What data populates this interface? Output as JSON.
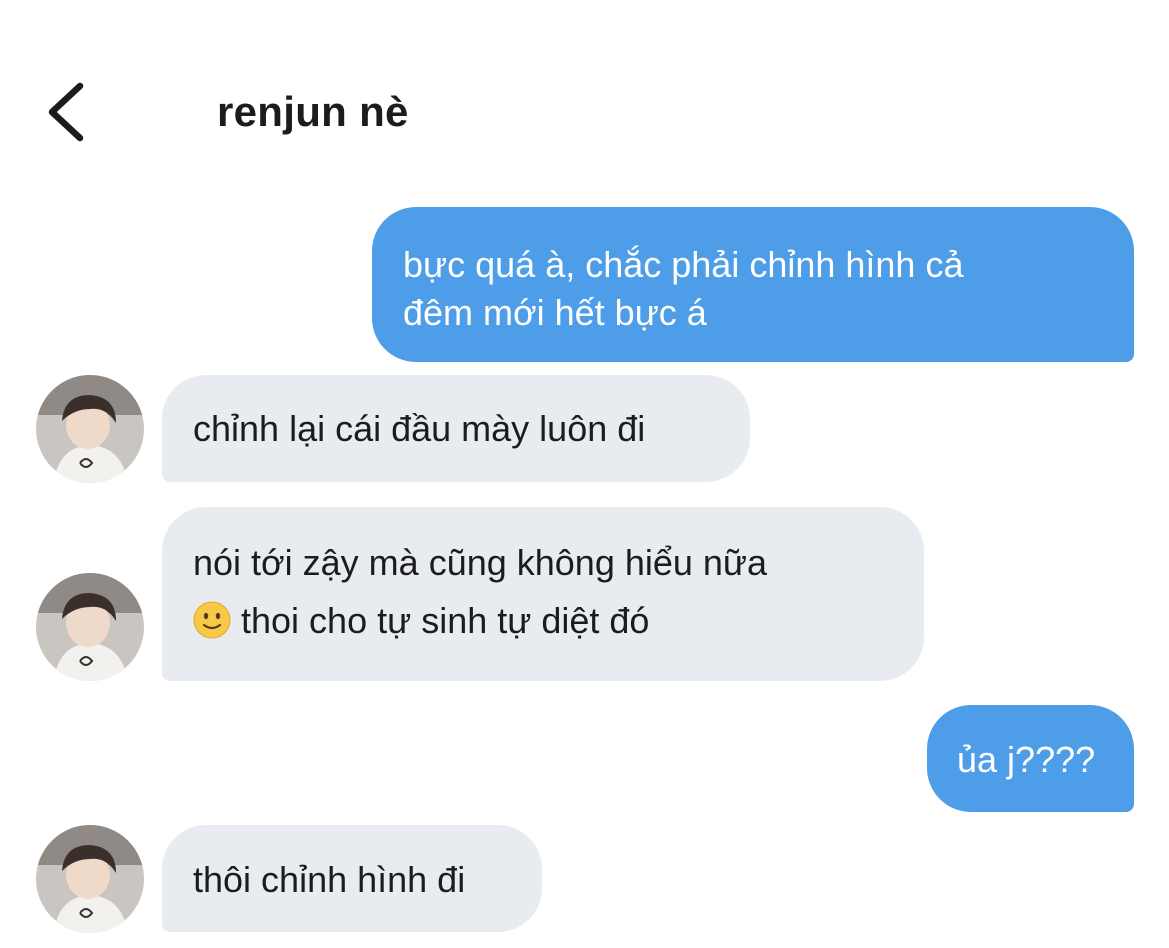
{
  "header": {
    "title": "renjun nè"
  },
  "messages": [
    {
      "direction": "outgoing",
      "lines": [
        "bực quá à, chắc phải chỉnh hình cả",
        "đêm mới hết bực á"
      ]
    },
    {
      "direction": "incoming",
      "lines": [
        "chỉnh lại cái đầu mày luôn đi"
      ]
    },
    {
      "direction": "incoming",
      "lines": [
        "nói tới zậy mà cũng không hiểu nữa",
        "thoi cho tự sinh tự diệt đó"
      ],
      "emoji": "slightly-smiling-face"
    },
    {
      "direction": "outgoing",
      "lines": [
        "ủa j????"
      ]
    },
    {
      "direction": "incoming",
      "lines": [
        "thôi chỉnh hình đi"
      ]
    }
  ],
  "colors": {
    "outgoing_bubble": "#4d9de9",
    "incoming_bubble": "#e8ecf0",
    "text_dark": "#1c1c1e",
    "text_light": "#ffffff"
  }
}
